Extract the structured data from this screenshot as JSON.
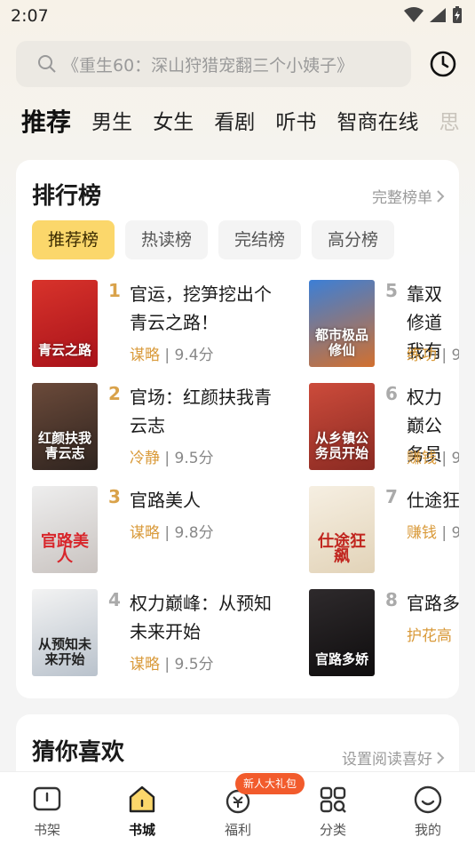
{
  "status": {
    "time": "2:07"
  },
  "search": {
    "placeholder": "《重生60：深山狩猎宠翻三个小姨子》"
  },
  "tabs": [
    {
      "label": "推荐",
      "active": true
    },
    {
      "label": "男生"
    },
    {
      "label": "女生"
    },
    {
      "label": "看剧"
    },
    {
      "label": "听书"
    },
    {
      "label": "智商在线"
    },
    {
      "label": "思"
    }
  ],
  "ranking": {
    "title": "排行榜",
    "more_label": "完整榜单",
    "chips": [
      {
        "label": "推荐榜",
        "active": true
      },
      {
        "label": "热读榜"
      },
      {
        "label": "完结榜"
      },
      {
        "label": "高分榜"
      }
    ],
    "books": [
      {
        "rank": "1",
        "title": "官运，挖笋挖出个青云之路！",
        "tag": "谋略",
        "score": "9.4分",
        "cover_text": "青云之路",
        "cover_colors": [
          "#d8332b",
          "#a8121a"
        ]
      },
      {
        "rank": "2",
        "title": "官场：红颜扶我青云志",
        "tag": "冷静",
        "score": "9.5分",
        "cover_text": "红颜扶我青云志",
        "cover_colors": [
          "#6b4a3a",
          "#2f241f"
        ]
      },
      {
        "rank": "3",
        "title": "官路美人",
        "tag": "谋略",
        "score": "9.8分",
        "cover_text": "官路美人",
        "cover_colors": [
          "#eeeeee",
          "#c9c3c0"
        ]
      },
      {
        "rank": "4",
        "title": "权力巅峰：从预知未来开始",
        "tag": "谋略",
        "score": "9.5分",
        "cover_text": "从预知未来开始",
        "cover_colors": [
          "#f3f3f3",
          "#b9c2cc"
        ]
      },
      {
        "rank": "5",
        "title": "靠双修道我有",
        "tag": "练功",
        "score": "9",
        "cover_text": "都市极品修仙",
        "cover_colors": [
          "#3c7fd6",
          "#d2702f"
        ]
      },
      {
        "rank": "6",
        "title": "权力巅公务员",
        "tag": "赚钱",
        "score": "9",
        "cover_text": "从乡镇公务员开始",
        "cover_colors": [
          "#cc4b3b",
          "#8a2a22"
        ]
      },
      {
        "rank": "7",
        "title": "仕途狂",
        "tag": "赚钱",
        "score": "9",
        "cover_text": "仕途狂飙",
        "cover_colors": [
          "#f6efe2",
          "#e2d3b8"
        ]
      },
      {
        "rank": "8",
        "title": "官路多",
        "tag": "护花高",
        "score": "",
        "cover_text": "官路多娇",
        "cover_colors": [
          "#2e2a2c",
          "#0f0d0e"
        ]
      }
    ]
  },
  "guess": {
    "title": "猜你喜欢",
    "more_label": "设置阅读喜好"
  },
  "nav": {
    "items": [
      {
        "label": "书架",
        "icon": "bookshelf-icon"
      },
      {
        "label": "书城",
        "icon": "bookstore-icon",
        "active": true
      },
      {
        "label": "福利",
        "icon": "welfare-icon"
      },
      {
        "label": "分类",
        "icon": "category-icon"
      },
      {
        "label": "我的",
        "icon": "profile-icon"
      }
    ],
    "badge": "新人大礼包"
  },
  "colors": {
    "accent": "#fbd76b",
    "tag": "#d99a3a",
    "rank_gold": "#d9a24a",
    "badge": "#f25b2c"
  }
}
